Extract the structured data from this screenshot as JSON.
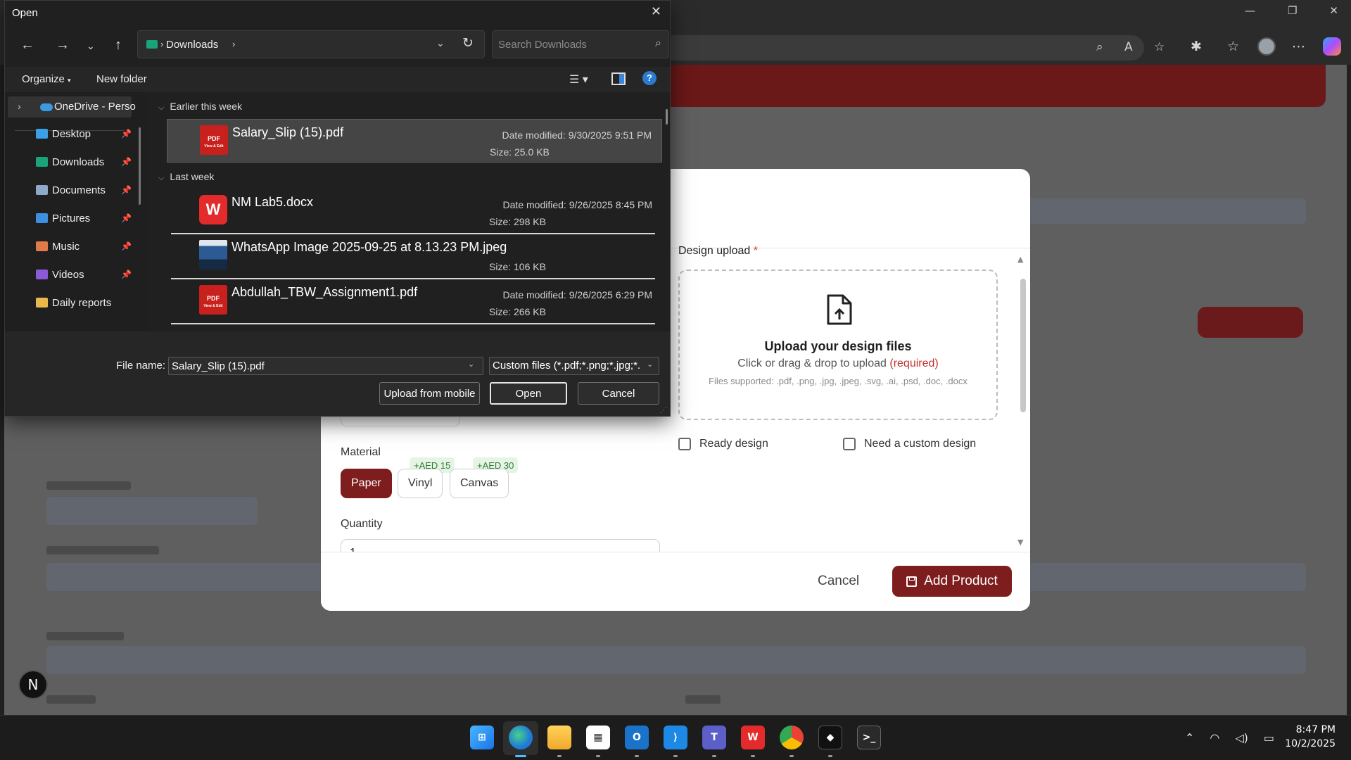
{
  "dialog": {
    "title": "Open",
    "path": "Downloads",
    "search_placeholder": "Search Downloads",
    "organize_label": "Organize",
    "new_folder_label": "New folder",
    "help_label": "?",
    "nav_pane": {
      "onedrive_label": "OneDrive - Perso",
      "items": [
        {
          "label": "Desktop",
          "icon": "desktop-folder-icon",
          "color": "#3aa0e8"
        },
        {
          "label": "Downloads",
          "icon": "downloads-folder-icon",
          "color": "#1aa37a"
        },
        {
          "label": "Documents",
          "icon": "documents-folder-icon",
          "color": "#8fa8c8"
        },
        {
          "label": "Pictures",
          "icon": "pictures-folder-icon",
          "color": "#3d8fe0"
        },
        {
          "label": "Music",
          "icon": "music-folder-icon",
          "color": "#e07a4a"
        },
        {
          "label": "Videos",
          "icon": "videos-folder-icon",
          "color": "#8a5ad8"
        },
        {
          "label": "Daily reports",
          "icon": "folder-icon",
          "color": "#e8b84a"
        }
      ]
    },
    "groups": [
      {
        "label": "Earlier this week",
        "files": [
          {
            "name": "Salary_Slip (15).pdf",
            "date": "Date modified: 9/30/2025 9:51 PM",
            "size": "Size: 25.0 KB",
            "icon": "pdf-icon",
            "selected": true
          }
        ]
      },
      {
        "label": "Last week",
        "files": [
          {
            "name": "NM Lab5.docx",
            "date": "Date modified: 9/26/2025 8:45 PM",
            "size": "Size: 298 KB",
            "icon": "wps-writer-icon",
            "selected": false
          },
          {
            "name": "WhatsApp Image 2025-09-25 at 8.13.23 PM.jpeg",
            "date": "",
            "size": "Size: 106 KB",
            "icon": "image-thumbnail-icon",
            "selected": false
          },
          {
            "name": "Abdullah_TBW_Assignment1.pdf",
            "date": "Date modified: 9/26/2025 6:29 PM",
            "size": "Size: 266 KB",
            "icon": "pdf-icon",
            "selected": false
          }
        ]
      }
    ],
    "pdf_icon_text": "PDF",
    "pdf_icon_sub": "View & Edit",
    "wps_icon_text": "W",
    "file_name_label": "File name:",
    "file_name_value": "Salary_Slip (15).pdf",
    "file_type": "Custom files (*.pdf;*.png;*.jpg;*.",
    "buttons": {
      "upload_mobile": "Upload from mobile",
      "open": "Open",
      "cancel": "Cancel"
    }
  },
  "modal": {
    "design_upload_label": "Design upload",
    "required_mark": "*",
    "dropzone": {
      "title": "Upload your design files",
      "subtitle": "Click or drag & drop to upload",
      "required_text": "(required)",
      "supported": "Files supported: .pdf, .png, .jpg, .jpeg, .svg, .ai, .psd, .doc, .docx"
    },
    "checkboxes": [
      {
        "label": "Ready design",
        "checked": false
      },
      {
        "label": "Need a custom design",
        "checked": false
      }
    ],
    "material_label": "Material",
    "materials": [
      {
        "label": "Paper",
        "selected": true,
        "price": ""
      },
      {
        "label": "Vinyl",
        "selected": false,
        "price": "+AED 15"
      },
      {
        "label": "Canvas",
        "selected": false,
        "price": "+AED 30"
      }
    ],
    "quantity_label": "Quantity",
    "quantity_value": "1",
    "cancel_label": "Cancel",
    "add_label": "Add Product",
    "accent_color": "#7e1d1d"
  },
  "browser": {
    "nx_badge": "N"
  },
  "taskbar": {
    "time": "8:47 PM",
    "date": "10/2/2025",
    "apps": [
      "start-icon",
      "edge-icon",
      "file-explorer-icon",
      "store-icon",
      "outlook-icon",
      "vscode-icon",
      "teams-icon",
      "wps-icon",
      "chrome-icon",
      "app-icon",
      "terminal-icon"
    ]
  }
}
